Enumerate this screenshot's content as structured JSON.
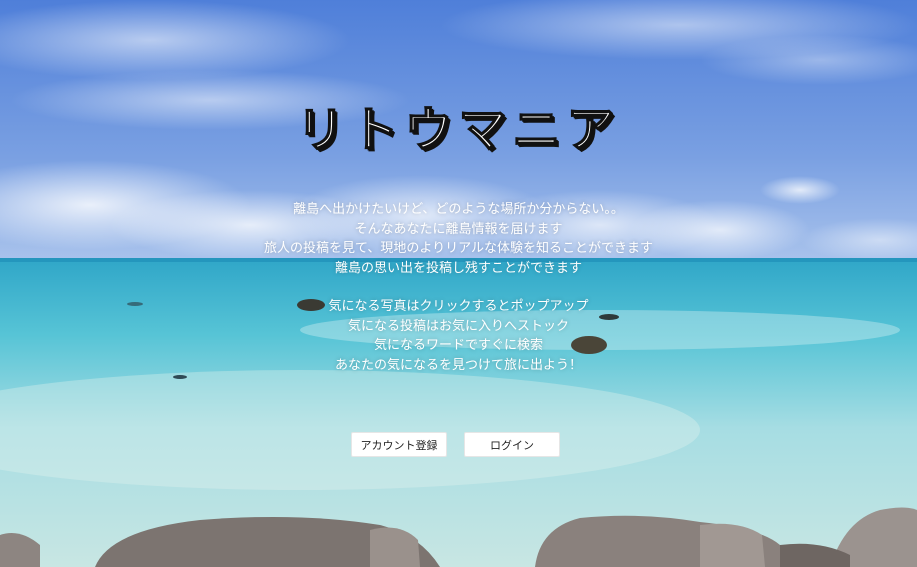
{
  "logo": {
    "text": "リトウマニア"
  },
  "intro": {
    "lines": [
      "離島へ出かけたいけど、どのような場所か分からない。。",
      "そんなあなたに離島情報を届けます",
      "旅人の投稿を見て、現地のよりリアルな体験を知ることができます",
      "離島の思い出を投稿し残すことができます"
    ]
  },
  "features": {
    "lines": [
      "気になる写真はクリックするとポップアップ",
      "気になる投稿はお気に入りへストック",
      "気になるワードですぐに検索",
      "あなたの気になるを見つけて旅に出よう！"
    ]
  },
  "buttons": {
    "register_label": "アカウント登録",
    "login_label": "ログイン"
  },
  "colors": {
    "sky": "#5f87d8",
    "sea": "#3fb8d0",
    "text": "#ffffff"
  }
}
